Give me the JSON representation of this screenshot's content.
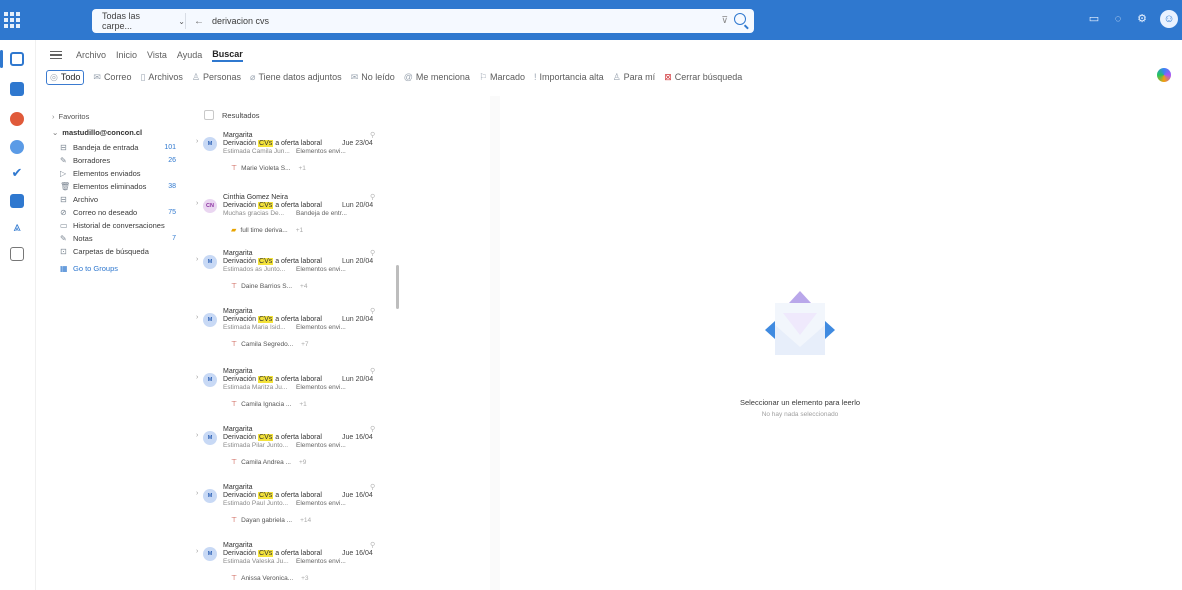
{
  "search": {
    "scope_label": "Todas las carpe...",
    "query": "derivacion cvs"
  },
  "menu": {
    "tabs": [
      "Archivo",
      "Inicio",
      "Vista",
      "Ayuda",
      "Buscar"
    ],
    "active_tab": "Buscar"
  },
  "filters": {
    "items": [
      {
        "label": "Todo",
        "icon": "all-icon",
        "active": true
      },
      {
        "label": "Correo",
        "icon": "mail-icon"
      },
      {
        "label": "Archivos",
        "icon": "file-icon"
      },
      {
        "label": "Personas",
        "icon": "people-icon"
      },
      {
        "label": "Tiene datos adjuntos",
        "icon": "attachment-icon"
      },
      {
        "label": "No leído",
        "icon": "unread-icon"
      },
      {
        "label": "Me menciona",
        "icon": "mention-icon"
      },
      {
        "label": "Marcado",
        "icon": "flag-icon"
      },
      {
        "label": "Importancia alta",
        "icon": "important-icon"
      },
      {
        "label": "Para mí",
        "icon": "person-icon"
      },
      {
        "label": "Cerrar búsqueda",
        "icon": "close-search-icon"
      }
    ]
  },
  "folders": {
    "favorites": "Favoritos",
    "account": "mastudillo@concon.cl",
    "items": [
      {
        "label": "Bandeja de entrada",
        "count": "101",
        "icon": "inbox-icon"
      },
      {
        "label": "Borradores",
        "count": "26",
        "icon": "drafts-icon"
      },
      {
        "label": "Elementos enviados",
        "count": "",
        "icon": "sent-icon"
      },
      {
        "label": "Elementos eliminados",
        "count": "38",
        "icon": "trash-icon"
      },
      {
        "label": "Archivo",
        "count": "",
        "icon": "archive-icon"
      },
      {
        "label": "Correo no deseado",
        "count": "75",
        "icon": "junk-icon"
      },
      {
        "label": "Historial de conversaciones",
        "count": "",
        "icon": "history-icon"
      },
      {
        "label": "Notas",
        "count": "7",
        "icon": "notes-icon"
      },
      {
        "label": "Carpetas de búsqueda",
        "count": "",
        "icon": "search-folder-icon"
      }
    ],
    "go_to_groups": "Go to Groups"
  },
  "list": {
    "header": "Resultados",
    "messages": [
      {
        "initials": "M",
        "sender": "Margarita",
        "subject_pre": "Derivación ",
        "subject_hl": "CVs",
        "subject_post": " a oferta laboral",
        "date": "Jue 23/04",
        "preview": "Estimada Camila Jun...",
        "folder": "Elementos envi...",
        "attachment": "Marie Violeta S...",
        "more": "+1"
      },
      {
        "initials": "CN",
        "sender": "Cinthia Gomez Neira",
        "subject_pre": "Derivación ",
        "subject_hl": "CVs",
        "subject_post": " a oferta laboral",
        "date": "Lun 20/04",
        "preview": "Muchas gracias De...",
        "folder": "Bandeja de entr...",
        "attachment": "full time deriva...",
        "more": "+1"
      },
      {
        "initials": "M",
        "sender": "Margarita",
        "subject_pre": "Derivación ",
        "subject_hl": "CVs",
        "subject_post": " a oferta laboral",
        "date": "Lun 20/04",
        "preview": "Estimados as Junto...",
        "folder": "Elementos envi...",
        "attachment": "Daine Barrios S...",
        "more": "+4"
      },
      {
        "initials": "M",
        "sender": "Margarita",
        "subject_pre": "Derivación ",
        "subject_hl": "CVs",
        "subject_post": " a oferta laboral",
        "date": "Lun 20/04",
        "preview": "Estimada Maria Isid...",
        "folder": "Elementos envi...",
        "attachment": "Camila Segredo...",
        "more": "+7"
      },
      {
        "initials": "M",
        "sender": "Margarita",
        "subject_pre": "Derivación ",
        "subject_hl": "CVs",
        "subject_post": " a oferta laboral",
        "date": "Lun 20/04",
        "preview": "Estimada Maritza Ju...",
        "folder": "Elementos envi...",
        "attachment": "Camila Ignacia ...",
        "more": "+1"
      },
      {
        "initials": "M",
        "sender": "Margarita",
        "subject_pre": "Derivación ",
        "subject_hl": "CVs",
        "subject_post": " a oferta laboral",
        "date": "Jue 16/04",
        "preview": "Estimada Pilar Junto...",
        "folder": "Elementos envi...",
        "attachment": "Camila Andrea ...",
        "more": "+9"
      },
      {
        "initials": "M",
        "sender": "Margarita",
        "subject_pre": "Derivación ",
        "subject_hl": "CVs",
        "subject_post": " a oferta laboral",
        "date": "Jue 16/04",
        "preview": "Estimado Paul Junto...",
        "folder": "Elementos envi...",
        "attachment": "Dayan gabriela ...",
        "more": "+14"
      },
      {
        "initials": "M",
        "sender": "Margarita",
        "subject_pre": "Derivación ",
        "subject_hl": "CVs",
        "subject_post": " a oferta laboral",
        "date": "Jue 16/04",
        "preview": "Estimada Valeska Ju...",
        "folder": "Elementos envi...",
        "attachment": "Anissa Veronica...",
        "more": "+3"
      }
    ]
  },
  "reading": {
    "title": "Seleccionar un elemento para leerlo",
    "subtitle": "No hay nada seleccionado"
  },
  "colors": {
    "accent": "#2f78cf",
    "highlight": "#f3e23b"
  }
}
